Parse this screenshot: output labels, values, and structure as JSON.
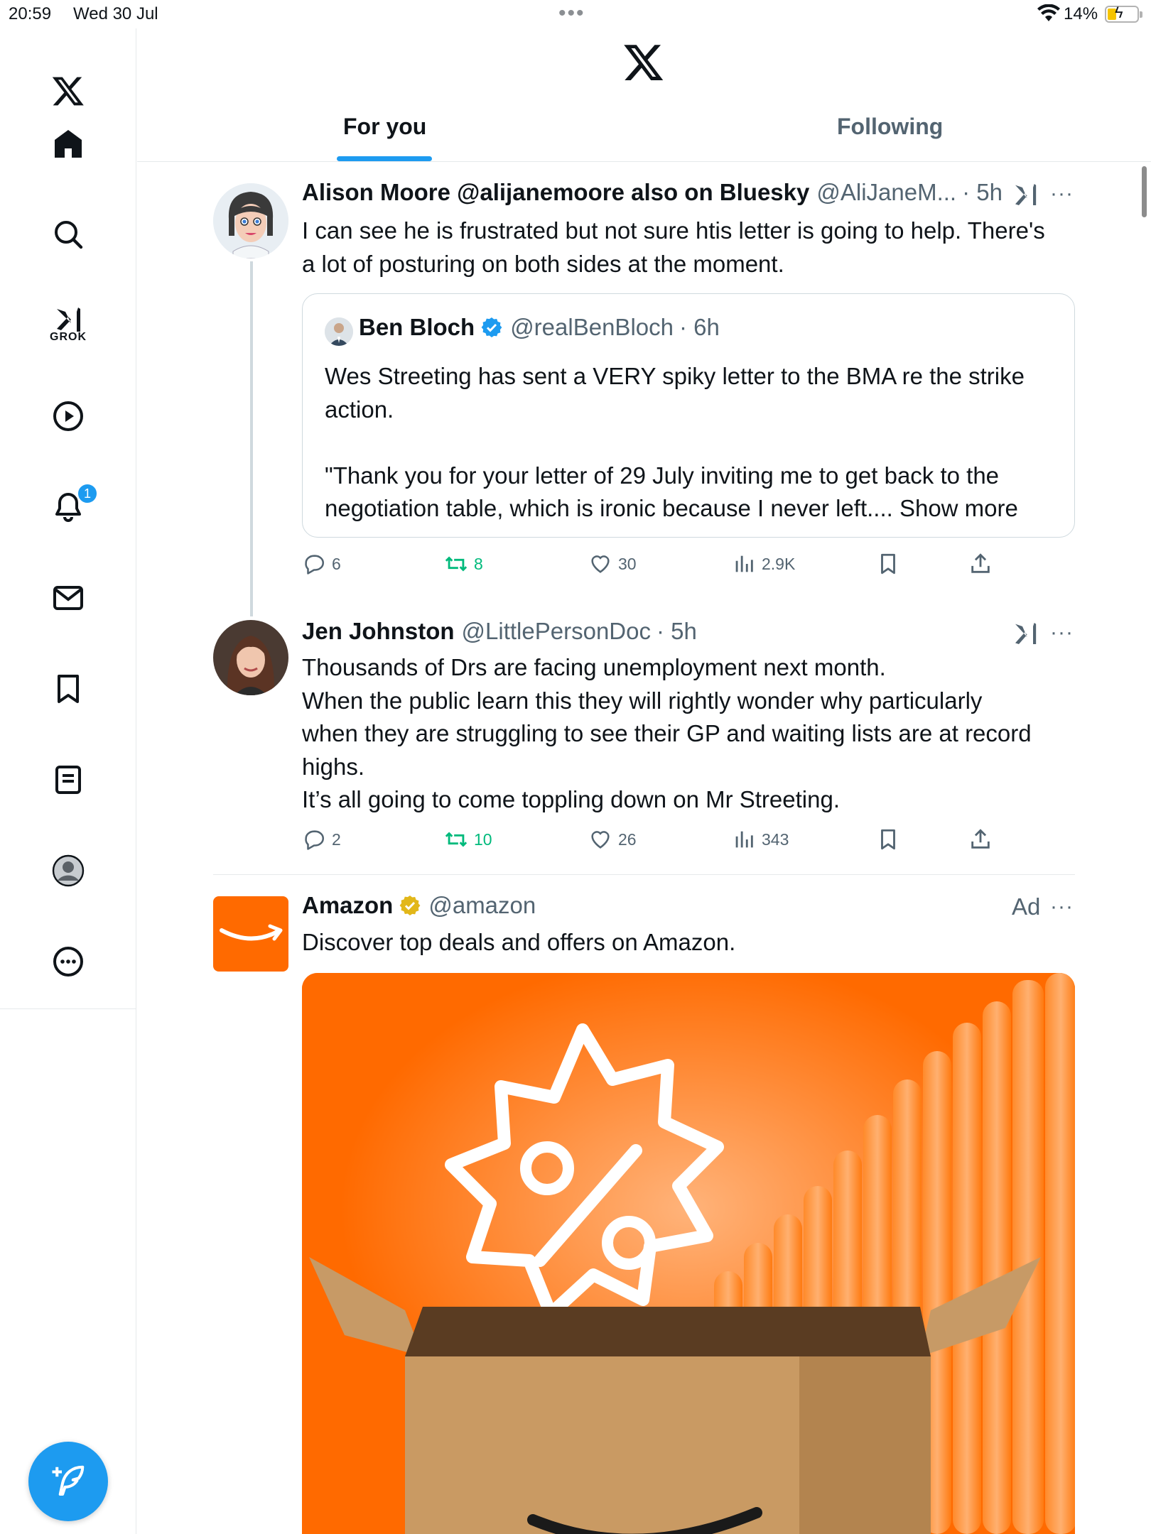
{
  "status_bar": {
    "time": "20:59",
    "date": "Wed 30 Jul",
    "battery": "14%"
  },
  "sidebar": {
    "grok_label": "GROK",
    "notification_count": "1",
    "items": [
      "home-icon",
      "search-icon",
      "grok-icon",
      "video-icon",
      "notifications-icon",
      "messages-icon",
      "bookmarks-icon",
      "lists-icon",
      "profile-icon",
      "more-icon"
    ]
  },
  "tabs": [
    {
      "label": "For you"
    },
    {
      "label": "Following"
    }
  ],
  "tweets": [
    {
      "name": "Alison Moore @alijanemoore also on Bluesky",
      "handle": "@AliJaneM...",
      "time": "· 5h",
      "lines": [
        "I can see he is frustrated but not sure htis letter is going to help. There's",
        "a lot of posturing on both sides at the moment."
      ],
      "quote": {
        "name": "Ben Bloch",
        "handle": "@realBenBloch",
        "time": "· 6h",
        "lines": [
          "Wes Streeting has sent a VERY spiky letter to the BMA re the strike",
          "action.",
          "",
          "\"Thank you for your letter of 29 July inviting me to get back to the",
          "negotiation table, which is ironic because I never left...."
        ],
        "show_more": "Show more"
      },
      "stats": {
        "replies": "6",
        "reposts": "8",
        "likes": "30",
        "views": "2.9K"
      }
    },
    {
      "name": "Jen Johnston",
      "handle": "@LittlePersonDoc",
      "time": "· 5h",
      "lines": [
        "Thousands of Drs are facing unemployment next month.",
        "When the public learn this they will rightly wonder why particularly",
        "when they are struggling to see their GP and waiting lists are at record",
        "highs.",
        "It’s all going to come toppling down on Mr Streeting."
      ],
      "stats": {
        "replies": "2",
        "reposts": "10",
        "likes": "26",
        "views": "343"
      }
    },
    {
      "name": "Amazon",
      "handle": "@amazon",
      "ad_label": "Ad",
      "lines": [
        "Discover top deals and offers on Amazon."
      ]
    }
  ],
  "colors": {
    "accent": "#1d9bf0",
    "repost_green": "#00ba7c",
    "secondary_text": "#536471",
    "gold_check": "#e2b719",
    "amazon_orange": "#ff6a00"
  }
}
